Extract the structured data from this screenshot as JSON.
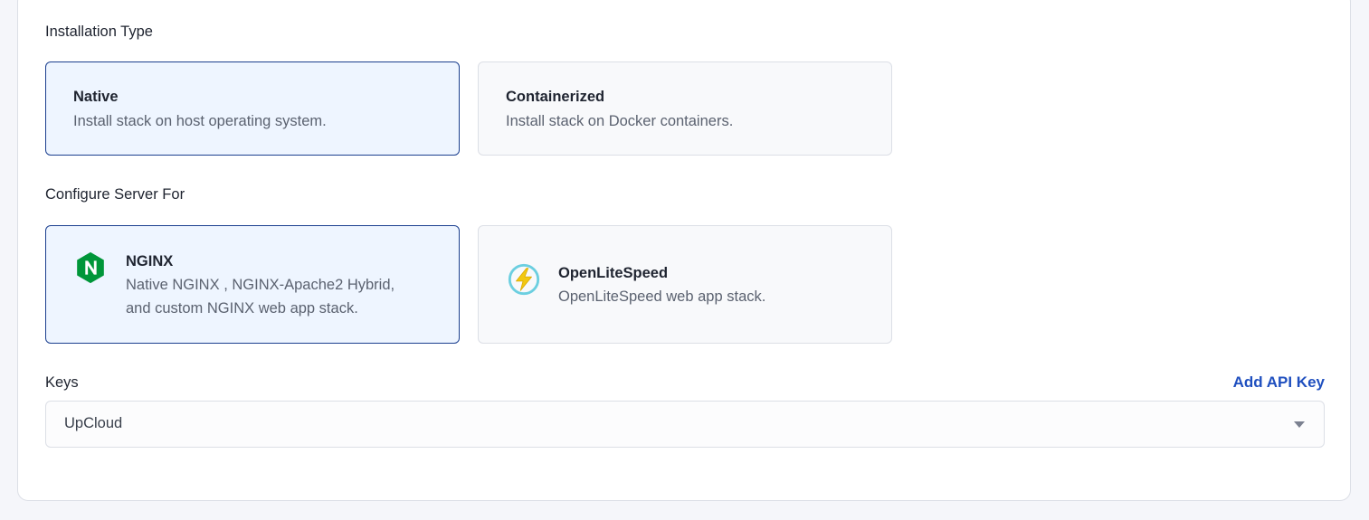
{
  "installation_type": {
    "label": "Installation Type",
    "options": [
      {
        "title": "Native",
        "description": "Install stack on host operating system.",
        "selected": true
      },
      {
        "title": "Containerized",
        "description": "Install stack on Docker containers.",
        "selected": false
      }
    ]
  },
  "configure_server": {
    "label": "Configure Server For",
    "options": [
      {
        "title": "NGINX",
        "description_line1": "Native NGINX , NGINX-Apache2 Hybrid,",
        "description_line2": "and custom NGINX web app stack.",
        "icon": "nginx-logo-icon",
        "selected": true
      },
      {
        "title": "OpenLiteSpeed",
        "description": "OpenLiteSpeed web app stack.",
        "icon": "openlitespeed-logo-icon",
        "selected": false
      }
    ]
  },
  "keys": {
    "label": "Keys",
    "add_link": "Add API Key",
    "selected_value": "UpCloud"
  },
  "colors": {
    "accent": "#1f4fbf",
    "selected_border": "#1b3f8f",
    "selected_bg": "#eef5ff",
    "nginx_green": "#009639",
    "ols_bolt": "#f2c811",
    "ols_ring": "#6ccfe0"
  }
}
